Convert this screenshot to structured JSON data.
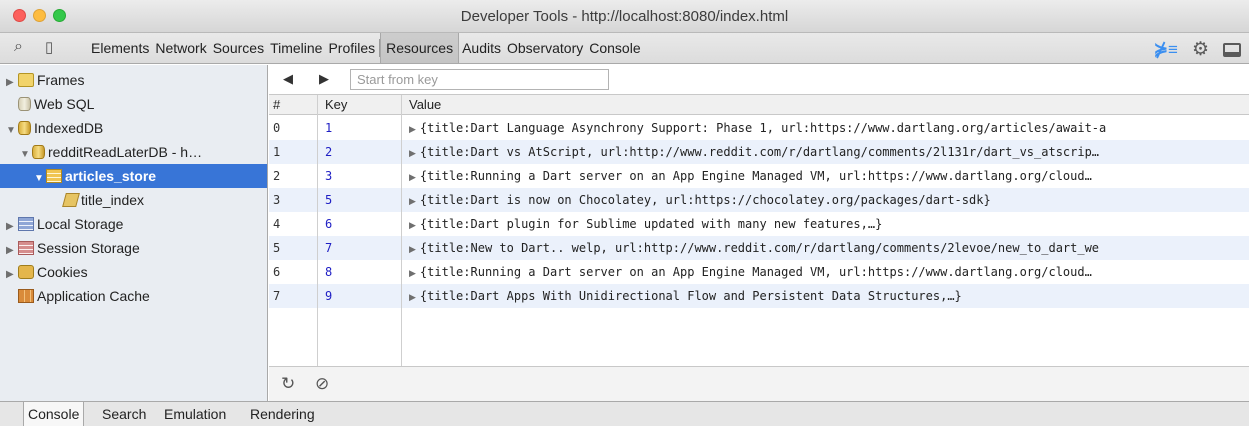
{
  "window": {
    "title": "Developer Tools - http://localhost:8080/index.html"
  },
  "toolbar": {
    "search_icon": "search-icon",
    "device_icon": "device-mode-icon",
    "tabs": [
      {
        "label": "Elements"
      },
      {
        "label": "Network"
      },
      {
        "label": "Sources"
      },
      {
        "label": "Timeline"
      },
      {
        "label": "Profiles"
      },
      {
        "label": "Resources",
        "active": true
      },
      {
        "label": "Audits"
      },
      {
        "label": "Observatory"
      },
      {
        "label": "Console"
      }
    ],
    "right_icons": [
      "drawer-toggle-icon",
      "gear-icon",
      "dock-icon"
    ]
  },
  "sidebar": {
    "items": [
      {
        "label": "Frames",
        "icon": "folder-icon",
        "expanded": false
      },
      {
        "label": "Web SQL",
        "icon": "database-icon"
      },
      {
        "label": "IndexedDB",
        "icon": "database-icon",
        "expanded": true
      },
      {
        "label": "redditReadLaterDB - h…",
        "icon": "database-icon",
        "expanded": true
      },
      {
        "label": "articles_store",
        "icon": "table-icon",
        "expanded": true,
        "selected": true
      },
      {
        "label": "title_index",
        "icon": "index-icon"
      },
      {
        "label": "Local Storage",
        "icon": "table-icon",
        "expanded": false
      },
      {
        "label": "Session Storage",
        "icon": "table-icon",
        "expanded": false
      },
      {
        "label": "Cookies",
        "icon": "cookie-icon",
        "expanded": false
      },
      {
        "label": "Application Cache",
        "icon": "app-cache-icon"
      }
    ]
  },
  "main": {
    "nav": {
      "prev_symbol": "◀",
      "next_symbol": "▶",
      "key_placeholder": "Start from key",
      "key_value": ""
    },
    "columns": [
      "#",
      "Key",
      "Value"
    ],
    "rows": [
      {
        "idx": "0",
        "key": "1",
        "value": "{title:Dart Language Asynchrony Support: Phase 1, url:https://www.dartlang.org/articles/await-a"
      },
      {
        "idx": "1",
        "key": "2",
        "value": "{title:Dart vs AtScript, url:http://www.reddit.com/r/dartlang/comments/2l131r/dart_vs_atscrip…"
      },
      {
        "idx": "2",
        "key": "3",
        "value": "{title:Running a Dart server on an App Engine Managed VM, url:https://www.dartlang.org/cloud…"
      },
      {
        "idx": "3",
        "key": "5",
        "value": "{title:Dart is now on Chocolatey, url:https://chocolatey.org/packages/dart-sdk}"
      },
      {
        "idx": "4",
        "key": "6",
        "value": "{title:Dart plugin for Sublime updated with many new features,…}"
      },
      {
        "idx": "5",
        "key": "7",
        "value": "{title:New to Dart.. welp, url:http://www.reddit.com/r/dartlang/comments/2levoe/new_to_dart_we"
      },
      {
        "idx": "6",
        "key": "8",
        "value": "{title:Running a Dart server on an App Engine Managed VM, url:https://www.dartlang.org/cloud…"
      },
      {
        "idx": "7",
        "key": "9",
        "value": "{title:Dart Apps With Unidirectional Flow and Persistent Data Structures,…}"
      }
    ],
    "footer": {
      "refresh_symbol": "↻",
      "clear_symbol": "⊘"
    }
  },
  "drawer": {
    "tabs": [
      {
        "label": "Console",
        "active": true
      },
      {
        "label": "Search"
      },
      {
        "label": "Emulation"
      },
      {
        "label": "Rendering"
      }
    ]
  },
  "colors": {
    "selection": "#3875d7",
    "alt_row": "#ebf1fb",
    "key_text": "#1f1fc4",
    "sidebar_bg": "#e9edf2"
  }
}
